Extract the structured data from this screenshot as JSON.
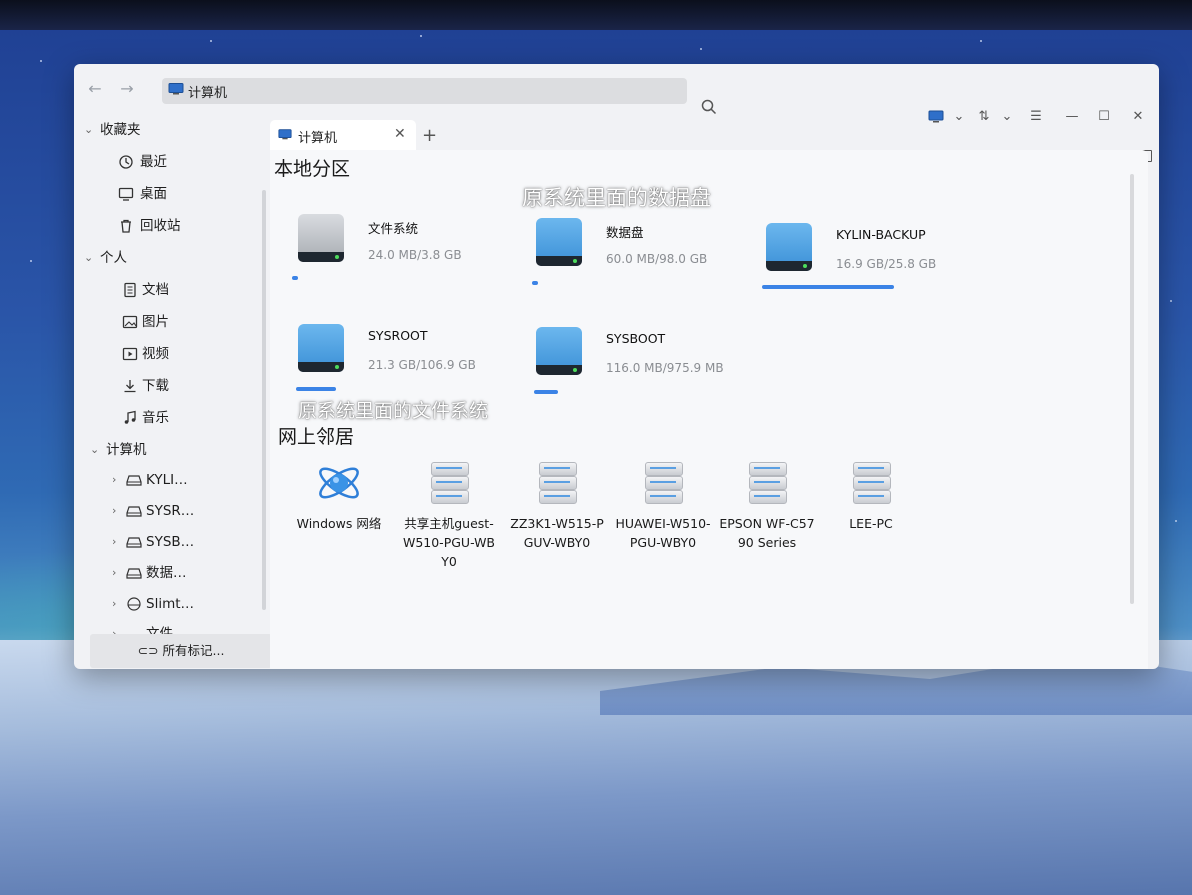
{
  "window": {
    "address": "计算机",
    "view_icon": "monitor-icon",
    "sort_icon": "sort-icon",
    "menu_icon": "hamburger-menu-icon"
  },
  "sidebar": {
    "sections": [
      {
        "label": "收藏夹",
        "items": [
          {
            "label": "最近",
            "icon": "clock-icon"
          },
          {
            "label": "桌面",
            "icon": "desktop-icon"
          },
          {
            "label": "回收站",
            "icon": "trash-icon"
          }
        ]
      },
      {
        "label": "个人",
        "items": [
          {
            "label": "文档",
            "icon": "document-icon"
          },
          {
            "label": "图片",
            "icon": "image-icon"
          },
          {
            "label": "视频",
            "icon": "video-icon"
          },
          {
            "label": "下载",
            "icon": "download-icon"
          },
          {
            "label": "音乐",
            "icon": "music-icon"
          }
        ]
      },
      {
        "label": "计算机",
        "items": [
          {
            "label": "KYLI…",
            "icon": "drive-icon"
          },
          {
            "label": "SYSR…",
            "icon": "drive-icon"
          },
          {
            "label": "SYSB…",
            "icon": "drive-icon"
          },
          {
            "label": "数据…",
            "icon": "drive-icon"
          },
          {
            "label": "Slimt…",
            "icon": "optical-drive-icon"
          },
          {
            "label": "文件…",
            "icon": "drive-icon"
          }
        ]
      }
    ],
    "all_tags": "所有标记..."
  },
  "tab": {
    "label": "计算机",
    "close": "✕",
    "add": "+"
  },
  "main": {
    "local_section": "本地分区",
    "network_section": "网上邻居",
    "drives": [
      {
        "name": "文件系统",
        "size": "24.0 MB/3.8 GB",
        "usage": 0.01,
        "color": "gray"
      },
      {
        "name": "数据盘",
        "size": "60.0 MB/98.0 GB",
        "usage": 0.01,
        "color": "blue"
      },
      {
        "name": "KYLIN-BACKUP",
        "size": "16.9 GB/25.8 GB",
        "usage": 0.66,
        "color": "blue"
      },
      {
        "name": "SYSROOT",
        "size": "21.3 GB/106.9 GB",
        "usage": 0.2,
        "color": "blue"
      },
      {
        "name": "SYSBOOT",
        "size": "116.0 MB/975.9 MB",
        "usage": 0.12,
        "color": "blue"
      }
    ],
    "hosts": [
      {
        "label": "Windows 网络",
        "icon": "windows-network-icon"
      },
      {
        "label": "共享主机guest-W510-PGU-WBY0",
        "icon": "server-icon"
      },
      {
        "label": "ZZ3K1-W515-PGUV-WBY0",
        "icon": "server-icon"
      },
      {
        "label": "HUAWEI-W510-PGU-WBY0",
        "icon": "server-icon"
      },
      {
        "label": "EPSON WF-C5790 Series",
        "icon": "server-icon"
      },
      {
        "label": "LEE-PC",
        "icon": "server-icon"
      }
    ]
  },
  "annotations": {
    "data_disk": "原系统里面的数据盘",
    "file_system": "原系统里面的文件系统"
  },
  "colors": {
    "accent": "#3b83e6",
    "disk_blue": "#4a9de0",
    "disk_gray": "#b8bcc2"
  }
}
